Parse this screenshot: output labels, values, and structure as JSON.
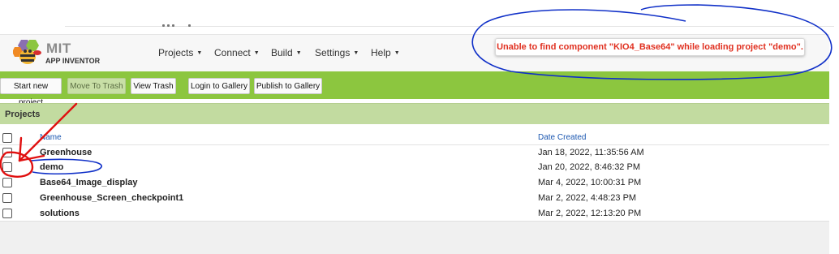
{
  "logo": {
    "mit": "MIT",
    "app_inventor": "APP INVENTOR"
  },
  "nav": {
    "items": [
      {
        "label": "Projects"
      },
      {
        "label": "Connect"
      },
      {
        "label": "Build"
      },
      {
        "label": "Settings"
      },
      {
        "label": "Help"
      }
    ],
    "caret": "▼"
  },
  "error_message": "Unable to find component \"KIO4_Base64\" while loading project \"demo\".",
  "toolbar": {
    "start_new_project": "Start new project",
    "move_to_trash": "Move To Trash",
    "view_trash": "View Trash",
    "login_to_gallery": "Login to Gallery",
    "publish_to_gallery": "Publish to Gallery"
  },
  "projects_panel": {
    "title": "Projects",
    "columns": {
      "name": "Name",
      "date_created": "Date Created"
    },
    "rows": [
      {
        "name": "Greenhouse",
        "date": "Jan 18, 2022, 11:35:56 AM"
      },
      {
        "name": "demo",
        "date": "Jan 20, 2022, 8:46:32 PM"
      },
      {
        "name": "Base64_Image_display",
        "date": "Mar 4, 2022, 10:00:31 PM"
      },
      {
        "name": "Greenhouse_Screen_checkpoint1",
        "date": "Mar 2, 2022, 4:48:23 PM"
      },
      {
        "name": "solutions",
        "date": "Mar 2, 2022, 12:13:20 PM"
      }
    ]
  },
  "colors": {
    "toolbar_green": "#8cc63f",
    "panel_header": "#c2dba0",
    "error_red": "#e03020",
    "annotation_blue": "#1030c8",
    "annotation_red": "#e01010"
  }
}
